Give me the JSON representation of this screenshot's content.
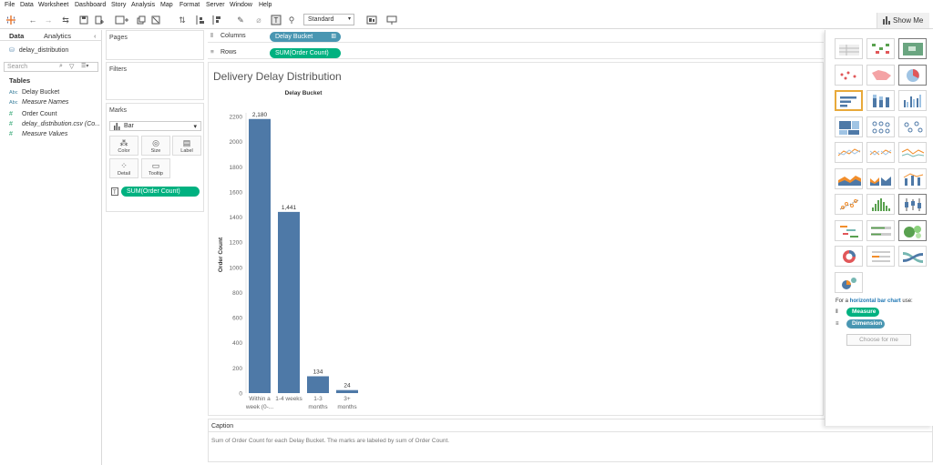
{
  "menu": [
    "File",
    "Data",
    "Worksheet",
    "Dashboard",
    "Story",
    "Analysis",
    "Map",
    "Format",
    "Server",
    "Window",
    "Help"
  ],
  "toolbar": {
    "fit_select": "Standard",
    "show_me_label": "Show Me"
  },
  "data_pane": {
    "tabs": [
      "Data",
      "Analytics"
    ],
    "datasource": "delay_distribution",
    "search_placeholder": "Search",
    "section_title": "Tables",
    "fields": [
      {
        "icon": "Abc",
        "name": "Delay Bucket",
        "italic": false,
        "kind": "dimension"
      },
      {
        "icon": "Abc",
        "name": "Measure Names",
        "italic": true,
        "kind": "dimension"
      },
      {
        "icon": "#",
        "name": "Order Count",
        "italic": false,
        "kind": "measure"
      },
      {
        "icon": "#",
        "name": "delay_distribution.csv (Co...",
        "italic": true,
        "kind": "measure"
      },
      {
        "icon": "#",
        "name": "Measure Values",
        "italic": true,
        "kind": "measure"
      }
    ]
  },
  "cards": {
    "pages": "Pages",
    "filters": "Filters",
    "marks": "Marks",
    "mark_type": "Bar",
    "mark_buttons": [
      {
        "label": "Color",
        "icon": "color-icon"
      },
      {
        "label": "Size",
        "icon": "size-icon"
      },
      {
        "label": "Label",
        "icon": "label-icon"
      },
      {
        "label": "Detail",
        "icon": "detail-icon"
      },
      {
        "label": "Tooltip",
        "icon": "tooltip-icon"
      }
    ],
    "marks_pill": "SUM(Order Count)"
  },
  "shelves": {
    "columns_label": "Columns",
    "columns_pill": "Delay Bucket",
    "rows_label": "Rows",
    "rows_pill": "SUM(Order Count)"
  },
  "sheet": {
    "title": "Delivery Delay Distribution"
  },
  "chart_data": {
    "type": "bar",
    "header": "Delay Bucket",
    "ylabel": "Order Count",
    "categories": [
      "Within a week (0-...",
      "1-4 weeks",
      "1-3 months",
      "3+ months"
    ],
    "category_lines": [
      [
        "Within a",
        "week (0-..."
      ],
      [
        "1-4 weeks"
      ],
      [
        "1-3",
        "months"
      ],
      [
        "3+",
        "months"
      ]
    ],
    "values": [
      2180,
      1441,
      134,
      24
    ],
    "value_labels": [
      "2,180",
      "1,441",
      "134",
      "24"
    ],
    "ylim": [
      0,
      2200
    ],
    "yticks": [
      0,
      200,
      400,
      600,
      800,
      1000,
      1200,
      1400,
      1600,
      1800,
      2000,
      2200
    ],
    "bar_color": "#4e79a7",
    "grid": false
  },
  "caption": {
    "title": "Caption",
    "text": "Sum of Order Count for each Delay Bucket.  The marks are labeled by sum of Order Count."
  },
  "show_me": {
    "hint_prefix": "For a ",
    "hint_chart": "horizontal bar chart",
    "hint_suffix": " use:",
    "req_measure": "Measure",
    "req_dimension": "Dimension",
    "button": "Choose for me",
    "highlight_color": "#e8a93a"
  }
}
